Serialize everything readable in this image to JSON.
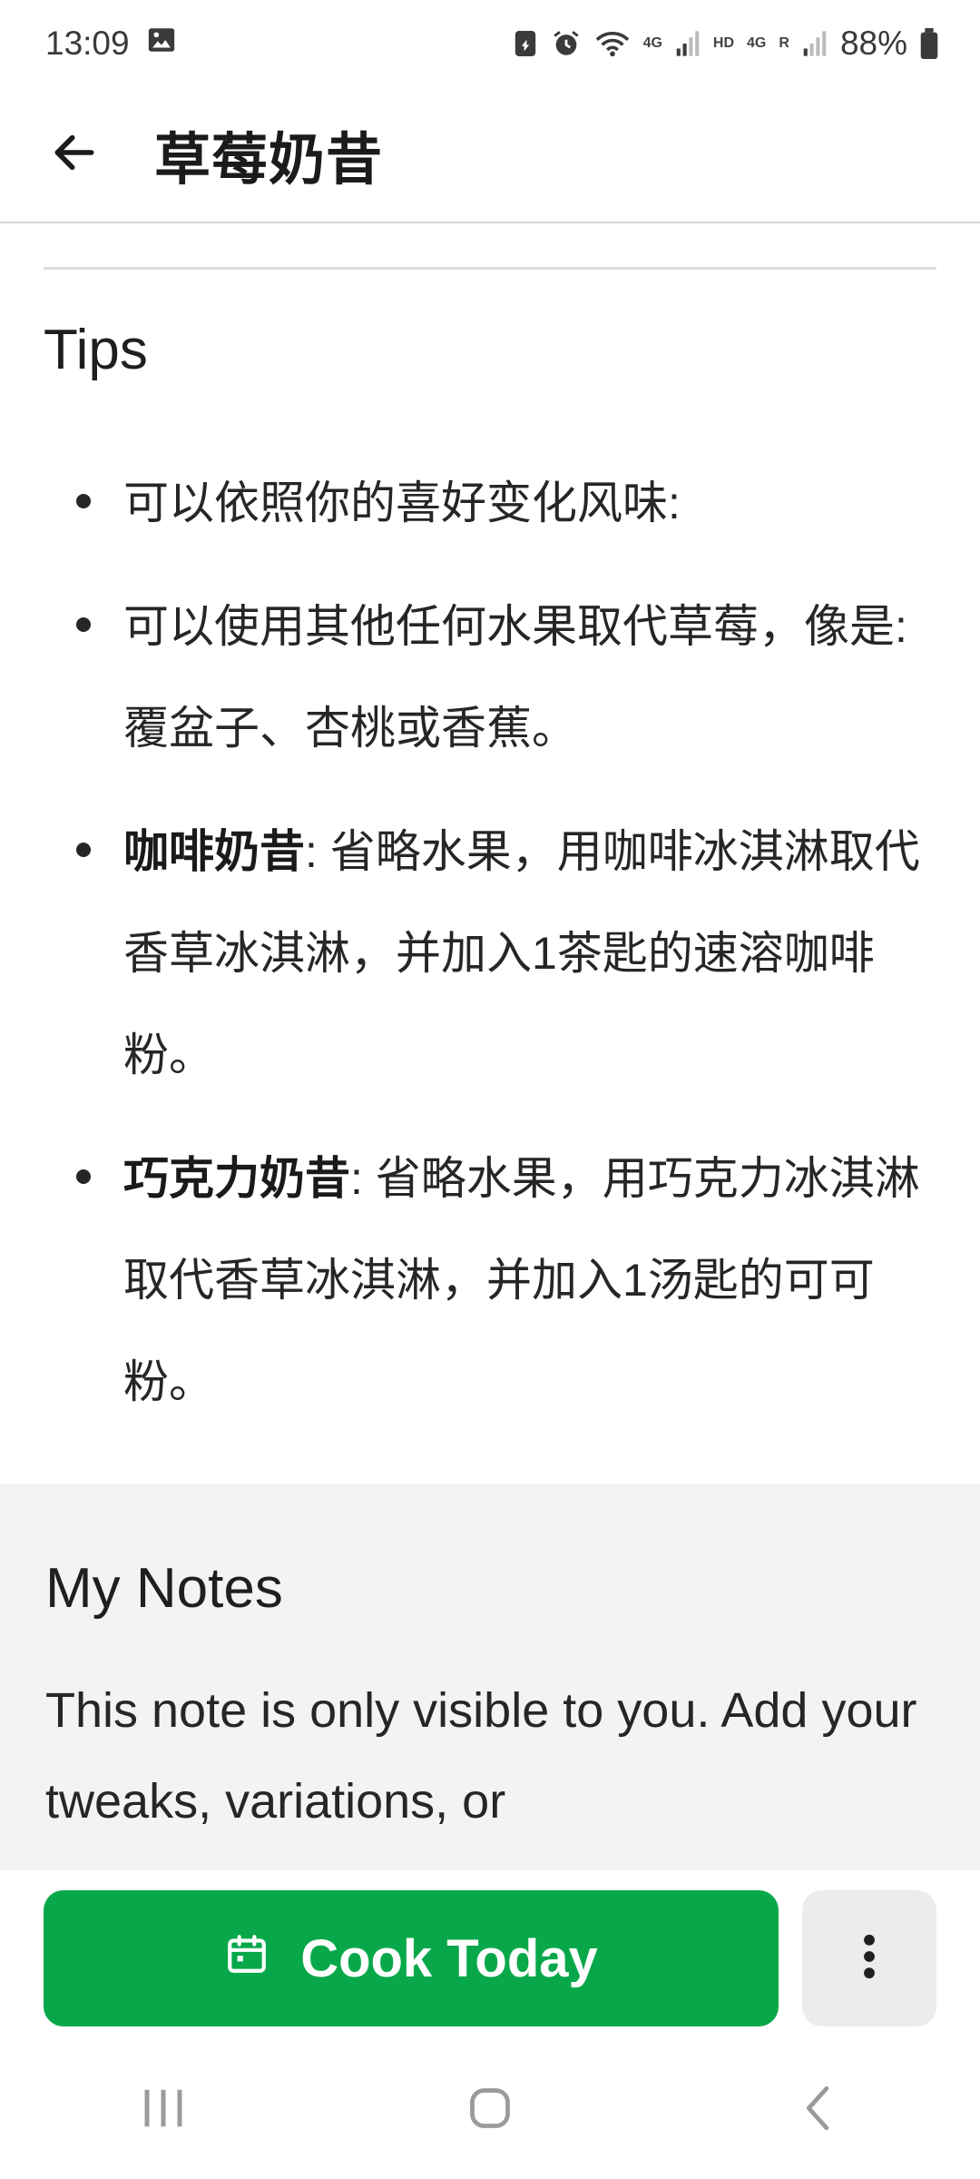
{
  "status_bar": {
    "time": "13:09",
    "network_labels": [
      "4G",
      "HD",
      "4G",
      "R"
    ],
    "battery": "88%"
  },
  "header": {
    "title": "草莓奶昔",
    "back_icon": "arrow-left-icon"
  },
  "tips": {
    "title": "Tips",
    "items": [
      {
        "bold": "",
        "text": "可以依照你的喜好变化风味:"
      },
      {
        "bold": "",
        "text": "可以使用其他任何水果取代草莓，像是:覆盆子、杏桃或香蕉。"
      },
      {
        "bold": "咖啡奶昔",
        "text": ": 省略水果，用咖啡冰淇淋取代香草冰淇淋，并加入1茶匙的速溶咖啡粉。"
      },
      {
        "bold": "巧克力奶昔",
        "text": ": 省略水果，用巧克力冰淇淋取代香草冰淇淋，并加入1汤匙的可可粉。"
      }
    ]
  },
  "notes": {
    "title": "My Notes",
    "text": "This note is only visible to you. Add your tweaks, variations, or"
  },
  "actions": {
    "cook_label": "Cook Today",
    "cook_icon": "calendar-icon",
    "more_icon": "more-vertical-icon",
    "accent": "#08a84a"
  },
  "nav": {
    "recents_icon": "recents-icon",
    "home_icon": "home-icon",
    "back_icon": "back-chevron-icon"
  }
}
